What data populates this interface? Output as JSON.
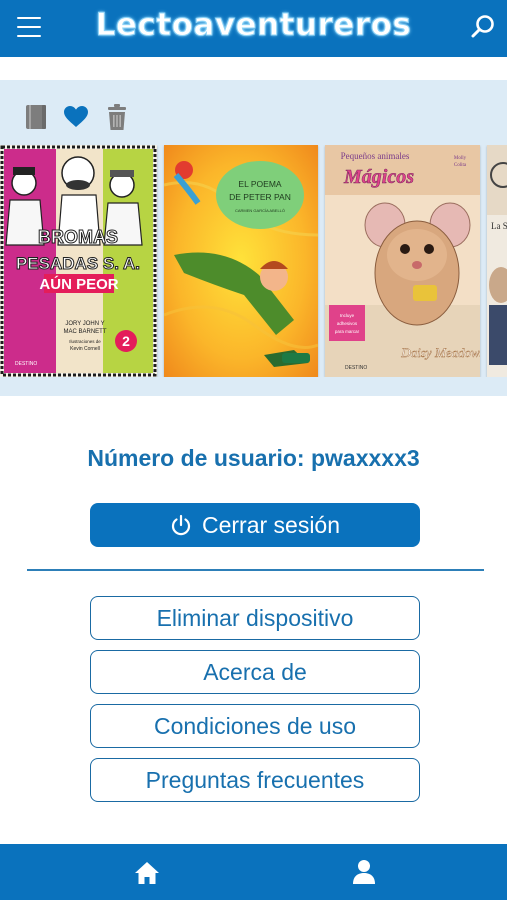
{
  "header": {
    "title": "Lectoaventureros",
    "menu_icon": "hamburger-menu-icon",
    "search_icon": "search-icon",
    "color": "#0a72bd"
  },
  "shelf": {
    "icons": [
      "book-icon",
      "heart-icon",
      "trash-icon"
    ],
    "books": [
      {
        "title": "BROMAS PESADAS S.A.",
        "subtitle": "AÚN PEOR",
        "authors": "JORY JOHN Y MAC BARNETT",
        "illustrator": "Ilustraciones de Kevin Cornell",
        "number": "2",
        "publisher": "DESTINO"
      },
      {
        "title": "EL POEMA DE PETER PAN",
        "author": "CARMEN GARCÍA ABELLÓ"
      },
      {
        "title": "Pequeños animales Mágicos",
        "author": "Daisy Meadows",
        "publisher": "DESTINO"
      },
      {
        "title": "La S"
      }
    ]
  },
  "account": {
    "user_label": "Número de usuario: pwaxxxx3",
    "logout_label": "Cerrar sesión"
  },
  "options": [
    {
      "label": "Eliminar dispositivo"
    },
    {
      "label": "Acerca de"
    },
    {
      "label": "Condiciones de uso"
    },
    {
      "label": "Preguntas frecuentes"
    }
  ],
  "bottom_nav": {
    "items": [
      "home-icon",
      "user-icon"
    ]
  }
}
